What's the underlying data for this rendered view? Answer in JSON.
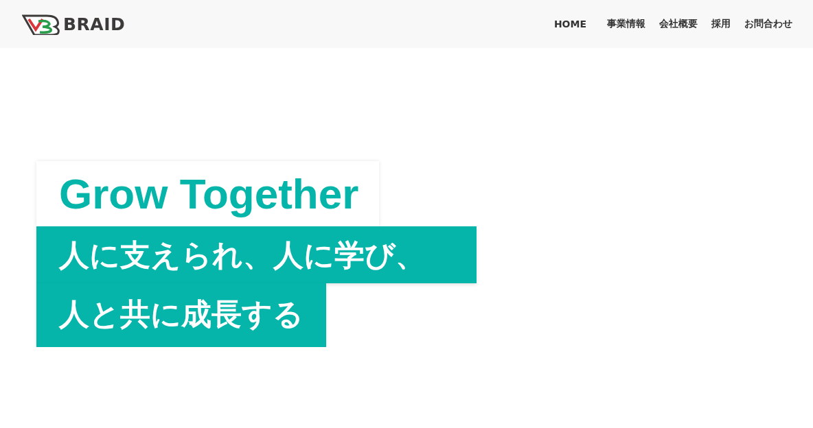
{
  "header": {
    "logo_text": "BRAID",
    "nav": [
      {
        "label": "HOME"
      },
      {
        "label": "事業情報"
      },
      {
        "label": "会社概要"
      },
      {
        "label": "採用"
      },
      {
        "label": "お問合わせ"
      }
    ]
  },
  "hero": {
    "title": "Grow Together",
    "tagline_lines": [
      "人に支えられ、人に学び、",
      "人と共に成長する"
    ]
  }
}
